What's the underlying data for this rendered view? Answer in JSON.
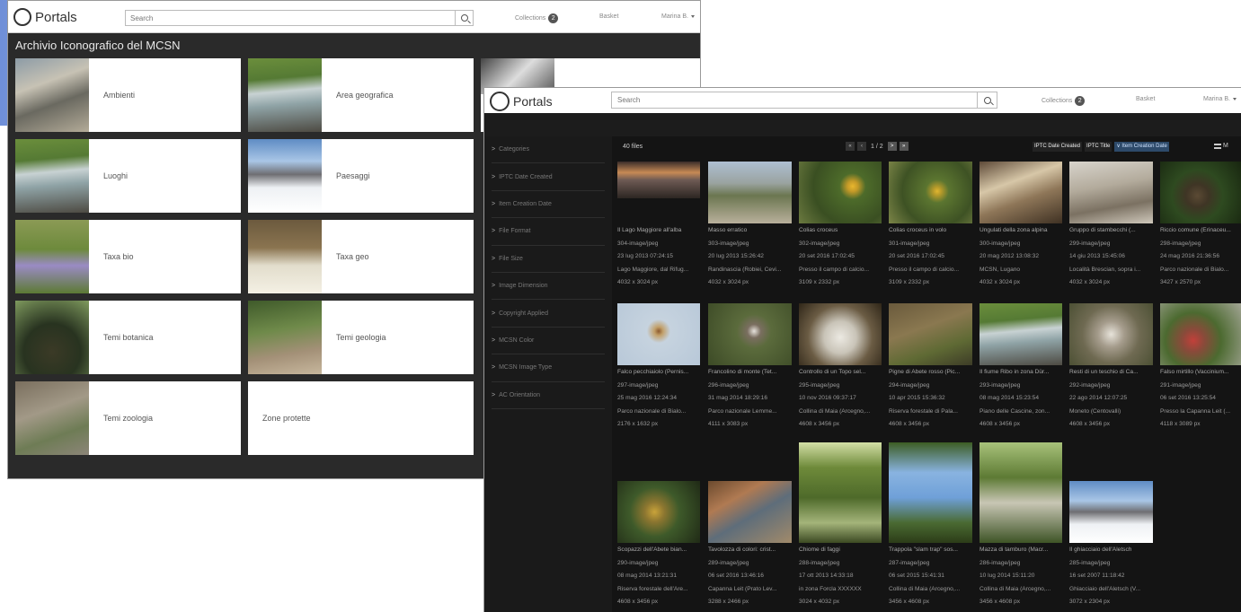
{
  "back_window": {
    "logo": "Portals",
    "search_placeholder": "Search",
    "nav": {
      "collections": "Collections",
      "collections_count": "2",
      "basket": "Basket",
      "user": "Marina B."
    },
    "title": "Archivio Iconografico del MCSN",
    "cards": [
      "Ambienti",
      "Area geografica",
      "Luoghi",
      "Paesaggi",
      "Taxa bio",
      "Taxa geo",
      "Temi botanica",
      "Temi geologia",
      "Temi zoologia",
      "Zone protette"
    ]
  },
  "front_window": {
    "logo": "Portals",
    "search_placeholder": "Search",
    "nav": {
      "collections": "Collections",
      "collections_count": "2",
      "basket": "Basket",
      "user": "Marina B."
    },
    "filters": [
      "Categories",
      "IPTC Date Created",
      "Item Creation Date",
      "File Format",
      "File Size",
      "Image Dimension",
      "Copyright Applied",
      "MCSN Color",
      "MCSN Image Type",
      "AC Orientation"
    ],
    "file_count": "40 files",
    "pager": {
      "first": "«",
      "prev": "‹",
      "page": "1 / 2",
      "next": ">",
      "last": "»"
    },
    "sort_options": [
      "IPTC Date Created",
      "IPTC Title",
      "∨ Item Creation Date"
    ],
    "view_label": "M",
    "files": [
      {
        "title": "Il Lago Maggiore all'alba",
        "type": "304-image/jpeg",
        "date": "23 lug 2013 07:24:15",
        "place": "Lago Maggiore, dal Rifug...",
        "size": "4032 x 3024 px"
      },
      {
        "title": "Masso erratico",
        "type": "303-image/jpeg",
        "date": "20 lug 2013 15:26:42",
        "place": "Randinascia (Robiei, Cevi...",
        "size": "4032 x 3024 px"
      },
      {
        "title": "Colias croceus",
        "type": "302-image/jpeg",
        "date": "20 set 2016 17:02:45",
        "place": "Presso il campo di calcio...",
        "size": "3109 x 2332 px"
      },
      {
        "title": "Colias croceus in volo",
        "type": "301-image/jpeg",
        "date": "20 set 2016 17:02:45",
        "place": "Presso il campo di calcio...",
        "size": "3109 x 2332 px"
      },
      {
        "title": "Ungulati della zona alpina",
        "type": "300-image/jpeg",
        "date": "20 mag 2012 13:08:32",
        "place": "MCSN, Lugano",
        "size": "4032 x 3024 px"
      },
      {
        "title": "Gruppo di stambecchi (...",
        "type": "299-image/jpeg",
        "date": "14 giu 2013 15:45:06",
        "place": "Località Brescian, sopra i...",
        "size": "4032 x 3024 px"
      },
      {
        "title": "Riccio comune (Erinaceu...",
        "type": "298-image/jpeg",
        "date": "24 mag 2016 21:36:56",
        "place": "Parco nazionale di Bialo...",
        "size": "3427 x 2570 px"
      },
      {
        "title": "Falco pecchiaiolo (Pernis...",
        "type": "297-image/jpeg",
        "date": "25 mag 2016 12:24:34",
        "place": "Parco nazionale di Bialo...",
        "size": "2176 x 1632 px"
      },
      {
        "title": "Francolino di monte (Tet...",
        "type": "296-image/jpeg",
        "date": "31 mag 2014 18:29:16",
        "place": "Parco nazionale Lemme...",
        "size": "4111 x 3083 px"
      },
      {
        "title": "Controllo di un Topo sel...",
        "type": "295-image/jpeg",
        "date": "10 nov 2016 09:37:17",
        "place": "Collina di Maia (Arcegno,...",
        "size": "4608 x 3456 px"
      },
      {
        "title": "Pigne di Abete rosso (Pic...",
        "type": "294-image/jpeg",
        "date": "10 apr 2015 15:36:32",
        "place": "Riserva forestale di Pala...",
        "size": "4608 x 3456 px"
      },
      {
        "title": "Il fiume Ribo in zona Dür...",
        "type": "293-image/jpeg",
        "date": "08 mag 2014 15:23:54",
        "place": "Piano delle Cascine, zon...",
        "size": "4608 x 3456 px"
      },
      {
        "title": "Resti di un teschio di Ca...",
        "type": "292-image/jpeg",
        "date": "22 ago 2014 12:07:25",
        "place": "Moneto (Centovalli)",
        "size": "4608 x 3456 px"
      },
      {
        "title": "Falso mirtillo (Vaccinium...",
        "type": "291-image/jpeg",
        "date": "06 set 2016 13:25:54",
        "place": "Presso la Capanna Leit (...",
        "size": "4118 x 3089 px"
      },
      {
        "title": "Scopazzi dell'Abete bian...",
        "type": "290-image/jpeg",
        "date": "08 mag 2014 13:21:31",
        "place": "Riserva forestale dell'Are...",
        "size": "4608 x 3456 px"
      },
      {
        "title": "Tavolozza di colori: crist...",
        "type": "289-image/jpeg",
        "date": "06 set 2016 13:46:16",
        "place": "Capanna Leit (Prato Lev...",
        "size": "3288 x 2466 px"
      },
      {
        "title": "Chiome di faggi",
        "type": "288-image/jpeg",
        "date": "17 ott 2013 14:33:18",
        "place": "in zona Forcla XXXXXX",
        "size": "3024 x 4032 px"
      },
      {
        "title": "Trappola \"slam trap\" sos...",
        "type": "287-image/jpeg",
        "date": "06 set 2015 15:41:31",
        "place": "Collina di Maia (Arcegno,...",
        "size": "3456 x 4608 px"
      },
      {
        "title": "Mazza di tamburo (Macr...",
        "type": "286-image/jpeg",
        "date": "10 lug 2014 15:11:20",
        "place": "Collina di Maia (Arcegno,...",
        "size": "3456 x 4608 px"
      },
      {
        "title": "Il ghiacciaio dell'Aletsch",
        "type": "285-image/jpeg",
        "date": "16 set 2007 11:18:42",
        "place": "Ghiacciaio dell'Aletsch (V...",
        "size": "3072 x 2304 px"
      }
    ]
  }
}
